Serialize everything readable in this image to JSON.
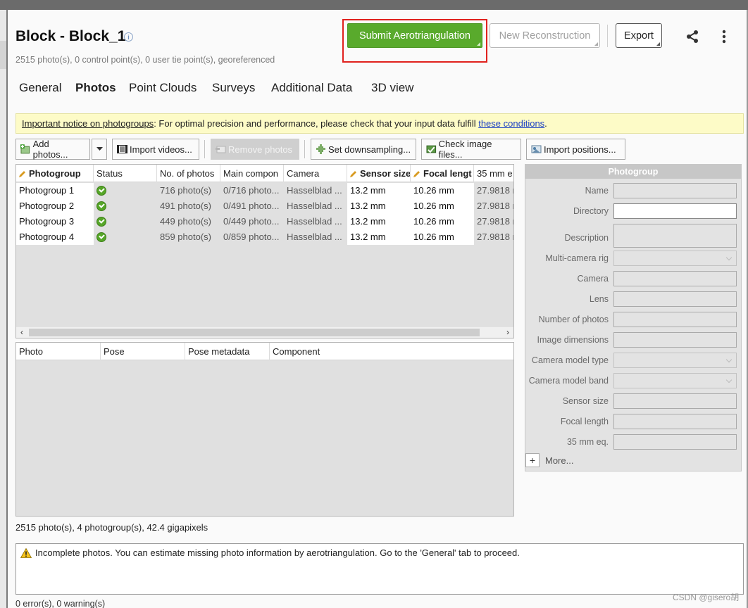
{
  "header": {
    "title": "Block - Block_1",
    "subtitle": "2515 photo(s), 0 control point(s), 0 user tie point(s), georeferenced",
    "submit_label": "Submit Aerotriangulation",
    "new_reconstruction_label": "New Reconstruction",
    "export_label": "Export"
  },
  "tabs": [
    "General",
    "Photos",
    "Point Clouds",
    "Surveys",
    "Additional Data",
    "3D view"
  ],
  "active_tab": "Photos",
  "notice": {
    "link_label": "Important notice on photogroups",
    "text": ": For optimal precision and performance, please check that your input data fulfill ",
    "conditions_link": "these conditions",
    "end": "."
  },
  "toolbar": {
    "add_photos": "Add photos...",
    "import_videos": "Import videos...",
    "remove_photos": "Remove photos",
    "set_downsampling": "Set downsampling...",
    "check_image_files": "Check image files...",
    "import_positions": "Import positions..."
  },
  "photogroups_table": {
    "columns": [
      "Photogroup",
      "Status",
      "No. of photos",
      "Main compon",
      "Camera",
      "Sensor size",
      "Focal lengt",
      "35 mm e"
    ],
    "rows": [
      {
        "photogroup": "Photogroup 1",
        "photos": "716 photo(s)",
        "main_component": "0/716 photo...",
        "camera": "Hasselblad ...",
        "sensor_size": "13.2 mm",
        "focal_length": "10.26 mm",
        "eq35": "27.9818 r"
      },
      {
        "photogroup": "Photogroup 2",
        "photos": "491 photo(s)",
        "main_component": "0/491 photo...",
        "camera": "Hasselblad ...",
        "sensor_size": "13.2 mm",
        "focal_length": "10.26 mm",
        "eq35": "27.9818 r"
      },
      {
        "photogroup": "Photogroup 3",
        "photos": "449 photo(s)",
        "main_component": "0/449 photo...",
        "camera": "Hasselblad ...",
        "sensor_size": "13.2 mm",
        "focal_length": "10.26 mm",
        "eq35": "27.9818 r"
      },
      {
        "photogroup": "Photogroup 4",
        "photos": "859 photo(s)",
        "main_component": "0/859 photo...",
        "camera": "Hasselblad ...",
        "sensor_size": "13.2 mm",
        "focal_length": "10.26 mm",
        "eq35": "27.9818 r"
      }
    ]
  },
  "photos_table": {
    "columns": [
      "Photo",
      "Pose",
      "Pose metadata",
      "Component"
    ]
  },
  "panel": {
    "title": "Photogroup",
    "labels": {
      "name": "Name",
      "directory": "Directory",
      "description": "Description",
      "multi_camera_rig": "Multi-camera rig",
      "camera": "Camera",
      "lens": "Lens",
      "number_of_photos": "Number of photos",
      "image_dimensions": "Image dimensions",
      "camera_model_type": "Camera model type",
      "camera_model_band": "Camera model band",
      "sensor_size": "Sensor size",
      "focal_length": "Focal length",
      "eq35": "35 mm eq."
    },
    "more_button": "+",
    "more_label": "More..."
  },
  "summary": "2515 photo(s), 4 photogroup(s), 42.4 gigapixels",
  "message": "Incomplete photos. You can estimate missing photo information by aerotriangulation. Go to the 'General' tab to proceed.",
  "status_line": "0 error(s), 0 warning(s)",
  "watermark": "CSDN @gisero胡",
  "colors": {
    "submit_green": "#59aa2c",
    "highlight_red": "#e0211d",
    "notice_yellow": "#fdfbc7",
    "link_blue": "#1a3fc4"
  }
}
